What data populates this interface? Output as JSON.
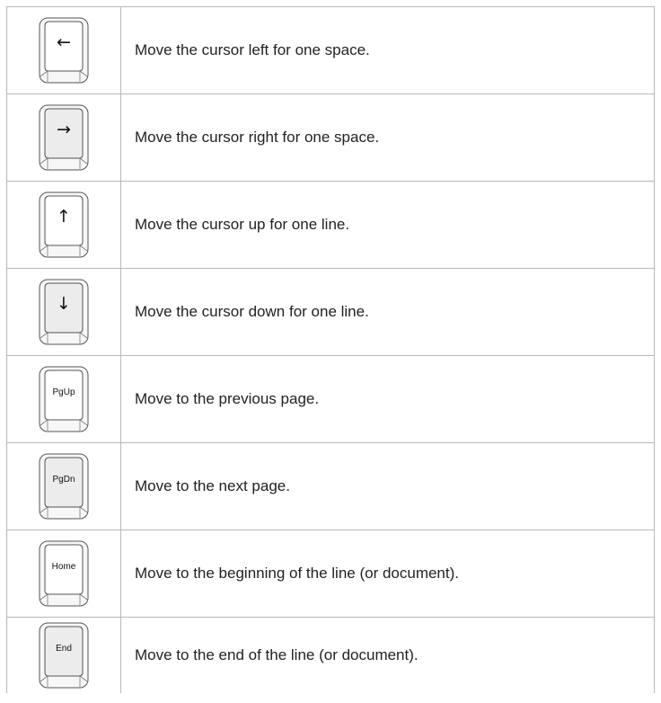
{
  "keys": [
    {
      "name": "left-arrow-key",
      "legend": "←",
      "arrow": true,
      "shaded": false,
      "description": "Move the cursor left for one space."
    },
    {
      "name": "right-arrow-key",
      "legend": "→",
      "arrow": true,
      "shaded": true,
      "description": "Move the cursor right for one space."
    },
    {
      "name": "up-arrow-key",
      "legend": "↑",
      "arrow": true,
      "shaded": false,
      "description": "Move the cursor up for one line."
    },
    {
      "name": "down-arrow-key",
      "legend": "↓",
      "arrow": true,
      "shaded": true,
      "description": "Move the cursor down for one line."
    },
    {
      "name": "pgup-key",
      "legend": "PgUp",
      "arrow": false,
      "shaded": false,
      "description": "Move to the previous page."
    },
    {
      "name": "pgdn-key",
      "legend": "PgDn",
      "arrow": false,
      "shaded": true,
      "description": "Move to the next page."
    },
    {
      "name": "home-key",
      "legend": "Home",
      "arrow": false,
      "shaded": false,
      "description": "Move to the beginning of the line (or document)."
    },
    {
      "name": "end-key",
      "legend": "End",
      "arrow": false,
      "shaded": true,
      "description": "Move to the end of the line (or document)."
    }
  ]
}
